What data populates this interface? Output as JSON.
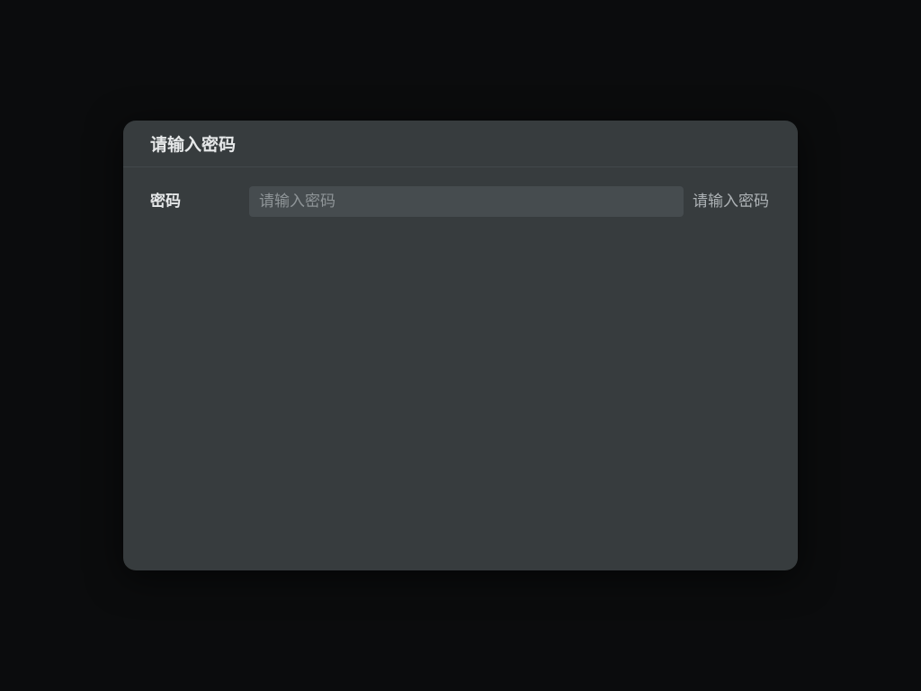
{
  "dialog": {
    "title": "请输入密码",
    "password_field": {
      "label": "密码",
      "value": "",
      "placeholder": "请输入密码",
      "hint": "请输入密码"
    }
  },
  "colors": {
    "backdrop": "#0b0c0d",
    "dialog_background": "#373c3e",
    "input_background": "#464c4f",
    "title_text": "#e6e8e9",
    "hint_text": "#aeb3b6"
  }
}
